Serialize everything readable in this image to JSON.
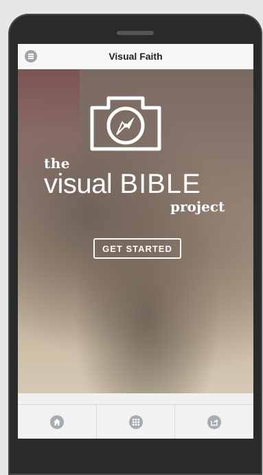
{
  "header": {
    "title": "Visual Faith",
    "menu_icon": "menu-icon"
  },
  "hero": {
    "logo_icon": "camera-compass-icon",
    "title_the": "the",
    "title_visual": "visual",
    "title_bible": "BIBLE",
    "title_project": "project",
    "cta_label": "GET STARTED"
  },
  "tabbar": {
    "items": [
      {
        "icon": "home-icon"
      },
      {
        "icon": "grid-icon"
      },
      {
        "icon": "share-icon"
      }
    ]
  },
  "colors": {
    "header_bg": "#f6f6f6",
    "tab_icon": "#a7acb1",
    "button_border": "#ffffff"
  }
}
